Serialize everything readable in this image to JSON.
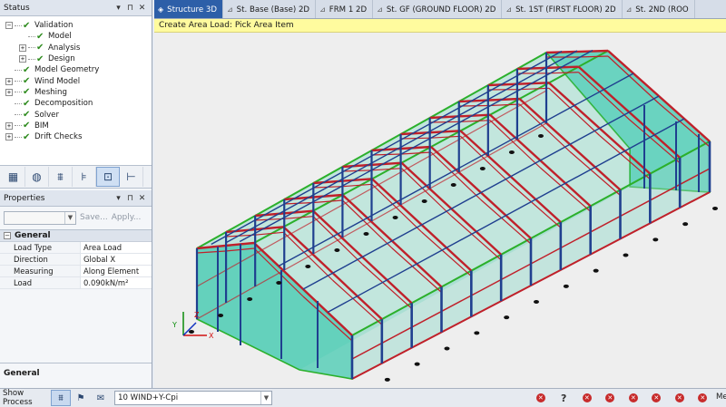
{
  "status_panel": {
    "title": "Status",
    "tree": [
      {
        "label": "Validation",
        "level": 0,
        "expander": "-",
        "check": true
      },
      {
        "label": "Model",
        "level": 1,
        "expander": "",
        "check": true
      },
      {
        "label": "Analysis",
        "level": 1,
        "expander": "+",
        "check": true
      },
      {
        "label": "Design",
        "level": 1,
        "expander": "+",
        "check": true
      },
      {
        "label": "Model Geometry",
        "level": 0,
        "expander": "",
        "check": true
      },
      {
        "label": "Wind Model",
        "level": 0,
        "expander": "+",
        "check": true
      },
      {
        "label": "Meshing",
        "level": 0,
        "expander": "+",
        "check": true
      },
      {
        "label": "Decomposition",
        "level": 0,
        "expander": "",
        "check": true
      },
      {
        "label": "Solver",
        "level": 0,
        "expander": "",
        "check": true
      },
      {
        "label": "BIM",
        "level": 0,
        "expander": "+",
        "check": true
      },
      {
        "label": "Drift Checks",
        "level": 0,
        "expander": "+",
        "check": true
      }
    ]
  },
  "toolstrip": [
    "structure-icon",
    "globe-icon",
    "load-icon",
    "frame-icon",
    "lock-icon",
    "member-icon"
  ],
  "properties_panel": {
    "title": "Properties",
    "save_label": "Save...",
    "apply_label": "Apply...",
    "category": "General",
    "rows": [
      {
        "key": "Load Type",
        "value": "Area Load"
      },
      {
        "key": "Direction",
        "value": "Global X"
      },
      {
        "key": "Measuring",
        "value": "Along Element"
      },
      {
        "key": "Load",
        "value": "0.090kN/m²"
      }
    ],
    "description_title": "General"
  },
  "tabs": [
    {
      "label": "Structure 3D",
      "active": true
    },
    {
      "label": "St. Base (Base) 2D",
      "active": false
    },
    {
      "label": "FRM 1 2D",
      "active": false
    },
    {
      "label": "St. GF (GROUND FLOOR) 2D",
      "active": false
    },
    {
      "label": "St. 1ST (FIRST FLOOR) 2D",
      "active": false
    },
    {
      "label": "St. 2ND (ROO",
      "active": false
    }
  ],
  "command_prompt": "Create Area Load: Pick Area Item",
  "axis_labels": {
    "x": "X",
    "y": "Y",
    "z": "Z"
  },
  "bottom_bar": {
    "show_process_label": "Show Process",
    "load_case_value": "10 WIND+Y-Cpi",
    "status_icons": [
      "error-icon",
      "help-icon",
      "error-icon",
      "error-icon",
      "error-icon",
      "error-icon",
      "error-icon",
      "error-icon"
    ],
    "tail_text": "Me"
  },
  "colors": {
    "accent_tab": "#2d5fa8",
    "command_bar": "#fffb9e",
    "rafter_red": "#c0202a",
    "column_blue": "#1f3f8f",
    "cladding_teal": "#3ec9b0",
    "edge_green": "#2bb02b"
  }
}
